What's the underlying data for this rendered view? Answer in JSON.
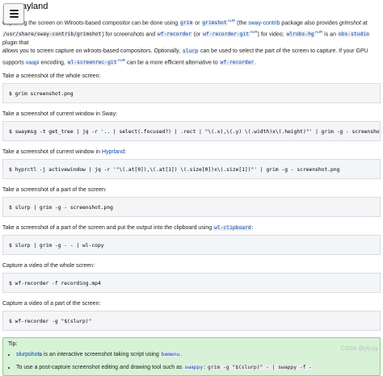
{
  "header": {
    "title": "ayland"
  },
  "intro": {
    "t1": "Capturing the screen on Wlroots-based compositor can be done using ",
    "grim": "grim",
    "t2": " or ",
    "grimshot": "grimshot",
    "t3": " (the ",
    "sway_contrib": "sway-contrib",
    "t4": " package also provides ",
    "grimshot_em": "grimshot",
    "t5": " at",
    "path": "/usr/share/sway-contrib/grimshot",
    "t6": ") for screenshots and ",
    "wf_recorder": "wf-recorder",
    "t7": " (or ",
    "wf_recorder_git": "wf-recorder-git",
    "t8": ") for video; ",
    "wlrobs_hg": "wlrobs-hg",
    "t9": " is an ",
    "obs_studio": "obs-studio",
    "t10": " plugin that",
    "t11": "allows you to screen capture on wlroots-based compositors. Optionally, ",
    "slurp": "slurp",
    "t12": " can be used to select the part of the screen to capture. If your GPU",
    "t13": "supports ",
    "vaapi": "vaapi",
    "t14": " encoding, ",
    "wl_screenrec_git": "wl-screenrec-git",
    "t15": " can be a more efficient alternative to ",
    "wf_recorder_2": "wf-recorder",
    "t16": ".",
    "aur": "AUR"
  },
  "sections": [
    {
      "text": "Take a screenshot of the whole screen:",
      "code": "$ grim screenshot.png"
    },
    {
      "text": "Take a screenshot of current window in Sway:",
      "code": "$ swaymsg -t get_tree | jq -r '.. | select(.focused?) | .rect | \"\\(.x),\\(.y) \\(.width)x\\(.height)\"' | grim -g - screenshot.png"
    },
    {
      "text_a": "Take a screenshot of current window in ",
      "link": "Hyprland",
      "text_b": ":",
      "code": "$ hyprctl -j activewindow | jq -r '\"\\(.at[0]),\\(.at[1]) \\(.size[0])x\\(.size[1])\"' | grim -g - screenshot.png"
    },
    {
      "text": "Take a screenshot of a part of the screen:",
      "code": "$ slurp | grim -g - screenshot.png"
    },
    {
      "text_a": "Take a screenshot of a part of the screen and put the output into the clipboard using ",
      "link": "wl-clipboard",
      "text_b": ":",
      "code": "$ slurp | grim -g - - | wl-copy"
    },
    {
      "text": "Capture a video of the whole screen:",
      "code": "$ wf-recorder -f recording.mp4"
    },
    {
      "text": "Capture a video of a part of the screen:",
      "code": "$ wf-recorder -g \"$(slurp)\""
    }
  ],
  "tip": {
    "title": "Tip:",
    "item1_link": "slurpshot",
    "item1_a": " is an interactive screenshot taking script using ",
    "item1_code": "bemenu",
    "item1_b": ".",
    "item2_a": "To use a post-capture screenshot editing and drawing tool such as ",
    "item2_code1": "swappy",
    "item2_b": ": ",
    "item2_code2": "grim -g \"$(slurp)\" - | swappy -f -"
  },
  "watermark": "CSDN @yly.py"
}
